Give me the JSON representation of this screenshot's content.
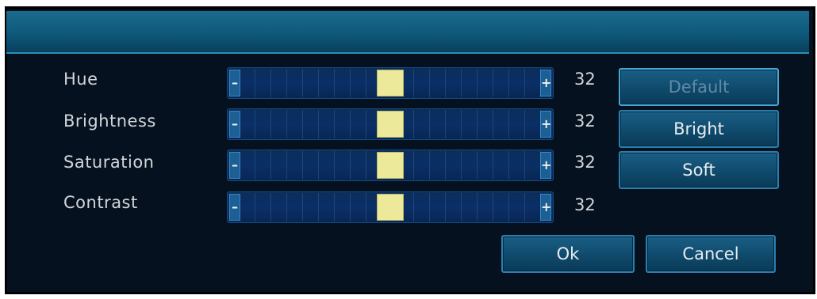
{
  "adjustments": [
    {
      "label": "Hue",
      "value": "32",
      "level": 0.5
    },
    {
      "label": "Brightness",
      "value": "32",
      "level": 0.5
    },
    {
      "label": "Saturation",
      "value": "32",
      "level": 0.5
    },
    {
      "label": "Contrast",
      "value": "32",
      "level": 0.5
    }
  ],
  "slider": {
    "minus_symbol": "–",
    "plus_symbol": "+"
  },
  "presets": {
    "default_label": "Default",
    "bright_label": "Bright",
    "soft_label": "Soft"
  },
  "actions": {
    "ok_label": "Ok",
    "cancel_label": "Cancel"
  },
  "colors": {
    "background": "#06111f",
    "titlebar": "#0f5a7d",
    "slider_thumb": "#ecea9a",
    "text": "#d2d6da"
  }
}
